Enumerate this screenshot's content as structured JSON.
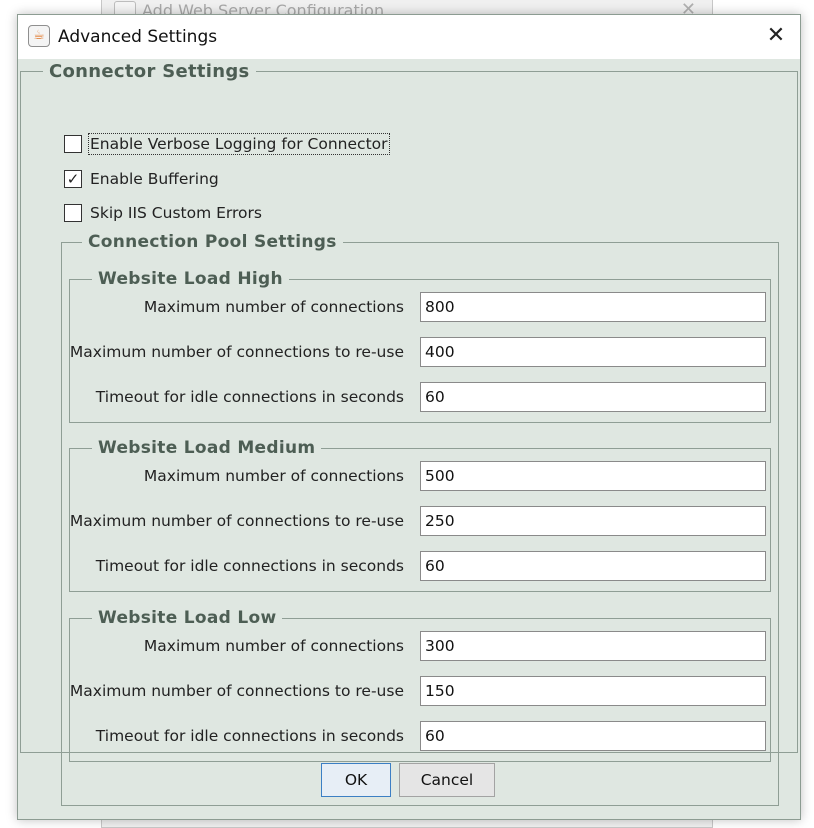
{
  "background_window": {
    "title": "Add Web Server Configuration",
    "close": "✕"
  },
  "dialog": {
    "title": "Advanced Settings",
    "icon": "java-cup-icon",
    "close_glyph": "✕"
  },
  "connector": {
    "legend": "Connector Settings",
    "options": [
      {
        "label": "Enable Verbose Logging for Connector",
        "checked": false,
        "mark": ""
      },
      {
        "label": "Enable Buffering",
        "checked": true,
        "mark": "✓"
      },
      {
        "label": "Skip IIS Custom Errors",
        "checked": false,
        "mark": ""
      }
    ]
  },
  "pool": {
    "legend": "Connection Pool Settings",
    "groups": [
      {
        "legend": "Website Load High",
        "fields": [
          {
            "label": "Maximum number of connections",
            "value": "800"
          },
          {
            "label": "Maximum number of connections to re-use",
            "value": "400"
          },
          {
            "label": "Timeout for idle connections in seconds",
            "value": "60"
          }
        ]
      },
      {
        "legend": "Website Load Medium",
        "fields": [
          {
            "label": "Maximum number of connections",
            "value": "500"
          },
          {
            "label": "Maximum number of connections to re-use",
            "value": "250"
          },
          {
            "label": "Timeout for idle connections in seconds",
            "value": "60"
          }
        ]
      },
      {
        "legend": "Website Load Low",
        "fields": [
          {
            "label": "Maximum number of connections",
            "value": "300"
          },
          {
            "label": "Maximum number of connections to re-use",
            "value": "150"
          },
          {
            "label": "Timeout for idle connections in seconds",
            "value": "60"
          }
        ]
      }
    ]
  },
  "buttons": {
    "ok": "OK",
    "cancel": "Cancel"
  },
  "colors": {
    "panel": "#dfe7e1",
    "legend": "#4d5e54",
    "default_button_border": "#3c7fc4"
  }
}
